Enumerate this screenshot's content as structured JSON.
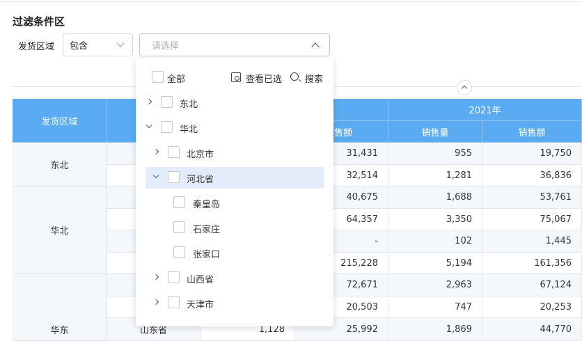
{
  "filter": {
    "section_title": "过滤条件区",
    "field_label": "发货区域",
    "operator_value": "包含",
    "value_placeholder": "请选择"
  },
  "dropdown": {
    "select_all": "全部",
    "view_selected": "查看已选",
    "search": "搜索",
    "tree": [
      {
        "label": "东北",
        "expanded": false
      },
      {
        "label": "华北",
        "expanded": true
      },
      {
        "label": "北京市",
        "expanded": false
      },
      {
        "label": "河北省",
        "expanded": true,
        "highlighted": true
      },
      {
        "label": "秦皇岛"
      },
      {
        "label": "石家庄"
      },
      {
        "label": "张家口"
      },
      {
        "label": "山西省",
        "expanded": false
      },
      {
        "label": "天津市",
        "expanded": false
      }
    ]
  },
  "table": {
    "col_region": "发货区域",
    "year_2021": "2021年",
    "col_sales_amount_partial": "售额",
    "col_sales_volume": "销售量",
    "col_sales_amount": "销售额",
    "regions": [
      "东北",
      "华北",
      "华东"
    ],
    "last_row_province": "山东省",
    "last_row_left_partial": "1,128",
    "rows": [
      {
        "amount_prev": "31,431",
        "qty": "955",
        "amount": "19,750"
      },
      {
        "amount_prev": "32,514",
        "qty": "1,281",
        "amount": "36,836"
      },
      {
        "amount_prev": "40,675",
        "qty": "1,688",
        "amount": "53,761"
      },
      {
        "amount_prev": "64,357",
        "qty": "3,350",
        "amount": "75,067"
      },
      {
        "amount_prev": "-",
        "qty": "102",
        "amount": "1,445"
      },
      {
        "amount_prev": "215,228",
        "qty": "5,194",
        "amount": "161,356"
      },
      {
        "amount_prev": "72,671",
        "qty": "2,963",
        "amount": "67,124"
      },
      {
        "amount_prev": "20,503",
        "qty": "747",
        "amount": "20,253"
      },
      {
        "amount_prev": "25,992",
        "qty": "1,869",
        "amount": "44,770"
      }
    ]
  }
}
